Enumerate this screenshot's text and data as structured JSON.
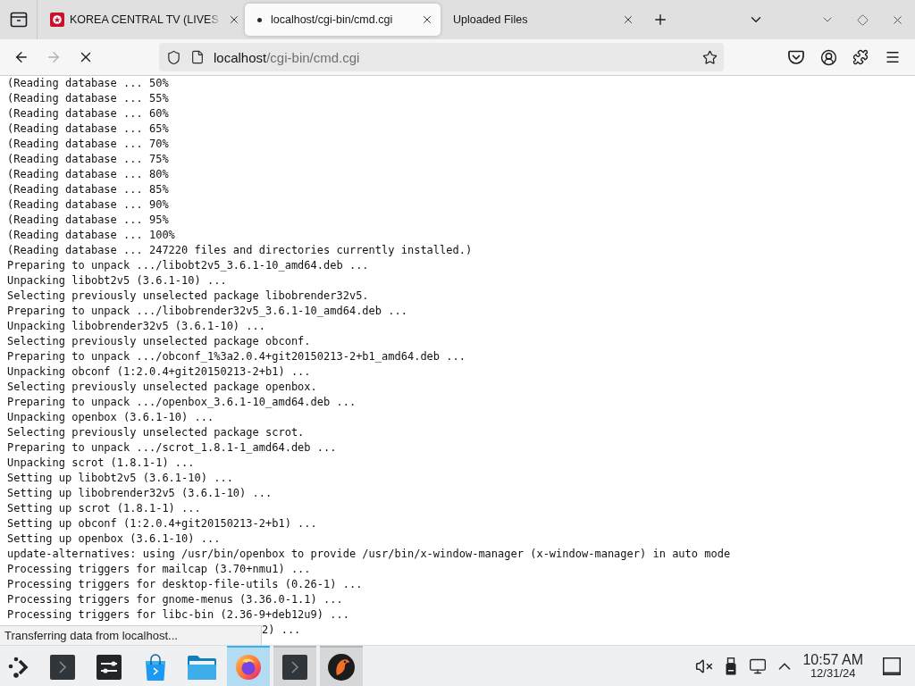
{
  "tab_strip": {
    "tabs": [
      {
        "title": "KOREA CENTRAL TV (LIVES",
        "selected": false,
        "loading": false,
        "favicon": true,
        "truncated": true
      },
      {
        "title": "localhost/cgi-bin/cmd.cgi",
        "selected": true,
        "loading": true,
        "favicon": false,
        "truncated": false
      },
      {
        "title": "Uploaded Files",
        "selected": false,
        "loading": false,
        "favicon": false,
        "truncated": false
      }
    ]
  },
  "toolbar": {
    "forward_disabled": true,
    "loading": true,
    "url_host": "localhost",
    "url_path": "/cgi-bin/cmd.cgi"
  },
  "page": {
    "lines": [
      "(Reading database ... 50%",
      "(Reading database ... 55%",
      "(Reading database ... 60%",
      "(Reading database ... 65%",
      "(Reading database ... 70%",
      "(Reading database ... 75%",
      "(Reading database ... 80%",
      "(Reading database ... 85%",
      "(Reading database ... 90%",
      "(Reading database ... 95%",
      "(Reading database ... 100%",
      "(Reading database ... 247220 files and directories currently installed.)",
      "Preparing to unpack .../libobt2v5_3.6.1-10_amd64.deb ...",
      "Unpacking libobt2v5 (3.6.1-10) ...",
      "Selecting previously unselected package libobrender32v5.",
      "Preparing to unpack .../libobrender32v5_3.6.1-10_amd64.deb ...",
      "Unpacking libobrender32v5 (3.6.1-10) ...",
      "Selecting previously unselected package obconf.",
      "Preparing to unpack .../obconf_1%3a2.0.4+git20150213-2+b1_amd64.deb ...",
      "Unpacking obconf (1:2.0.4+git20150213-2+b1) ...",
      "Selecting previously unselected package openbox.",
      "Preparing to unpack .../openbox_3.6.1-10_amd64.deb ...",
      "Unpacking openbox (3.6.1-10) ...",
      "Selecting previously unselected package scrot.",
      "Preparing to unpack .../scrot_1.8.1-1_amd64.deb ...",
      "Unpacking scrot (1.8.1-1) ...",
      "Setting up libobt2v5 (3.6.1-10) ...",
      "Setting up libobrender32v5 (3.6.1-10) ...",
      "Setting up scrot (1.8.1-1) ...",
      "Setting up obconf (1:2.0.4+git20150213-2+b1) ...",
      "Setting up openbox (3.6.1-10) ...",
      "update-alternatives: using /usr/bin/openbox to provide /usr/bin/x-window-manager (x-window-manager) in auto mode",
      "Processing triggers for mailcap (3.70+nmu1) ...",
      "Processing triggers for desktop-file-utils (0.26-1) ...",
      "Processing triggers for gnome-menus (3.36.0-1.1) ...",
      "Processing triggers for libc-bin (2.36-9+deb12u9) ..."
    ],
    "covered_line_tail": "2) ..."
  },
  "status_popup": {
    "text": "Transferring data from localhost..."
  },
  "taskbar": {
    "apps": [
      {
        "kind": "launcher",
        "selected": false,
        "open": false
      },
      {
        "kind": "terminal",
        "selected": false,
        "open": false
      },
      {
        "kind": "settings",
        "selected": false,
        "open": false
      },
      {
        "kind": "store",
        "selected": false,
        "open": false
      },
      {
        "kind": "files",
        "selected": false,
        "open": false
      },
      {
        "kind": "browser",
        "selected": true,
        "open": true
      },
      {
        "kind": "terminal",
        "selected": false,
        "open": true
      },
      {
        "kind": "bird",
        "selected": false,
        "open": true
      }
    ],
    "tray": {
      "volume_muted": true
    },
    "clock": {
      "time": "10:57 AM",
      "date": "12/31/24"
    }
  }
}
